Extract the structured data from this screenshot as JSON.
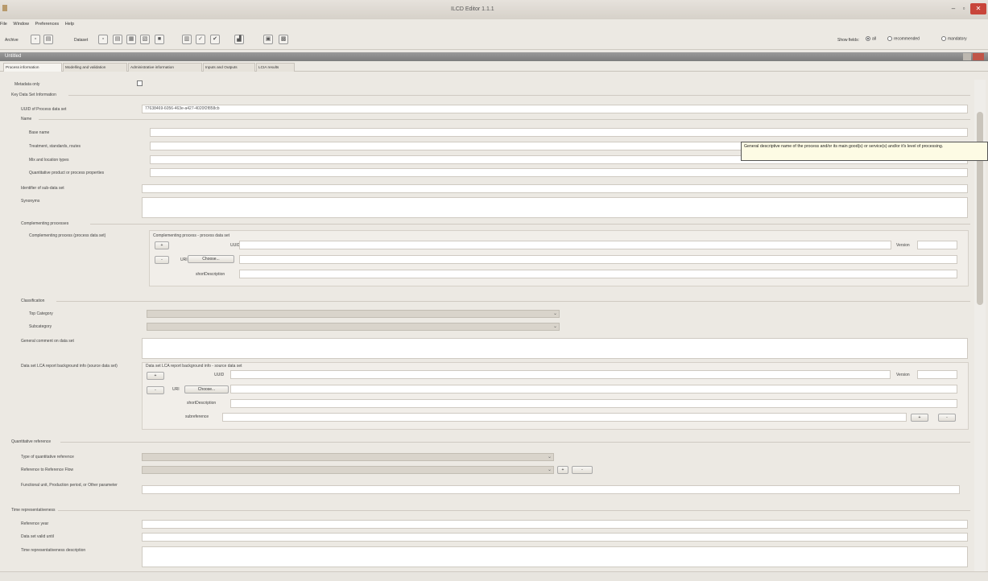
{
  "window": {
    "title": "ILCD Editor 1.1.1",
    "minimize": "–",
    "maximize": "▫",
    "close": "✕"
  },
  "menu": [
    "File",
    "Window",
    "Preferences",
    "Help"
  ],
  "toolbar": {
    "archive_label": "Archive",
    "dataset_label": "Dataset",
    "show_fields_label": "Show fields:",
    "show_fields_options": [
      "all",
      "recommended",
      "mandatory"
    ],
    "show_fields_selected": "all"
  },
  "document": {
    "title": "Untitled"
  },
  "tabs": [
    "Process information",
    "Modelling and validation",
    "Administrative information",
    "Inputs and Outputs",
    "LCIA results"
  ],
  "form": {
    "metadata_only": "Metadata only",
    "key_info": "Key Data Set Information",
    "uuid_label": "UUID of Process data set",
    "uuid_value": "77638469-6056-463e-a427-4020f2f858cb",
    "name": "Name",
    "base_name": "Base name",
    "treatment": "Treatment, standards, routes",
    "mix_location": "Mix and location types",
    "quant_props": "Quantitative product or process properties",
    "sub_dataset": "Identifier of sub-data set",
    "synonyms": "Synonyms",
    "complementing_processes": "Complementing processes",
    "complementing_process": "Complementing process (process data set)",
    "complementing_process_ref": "Complementing process - process data set",
    "uuid": "UUID",
    "version": "Version",
    "uri": "URI",
    "choose": "Choose...",
    "short_description": "shortDescription",
    "classification": "Classification",
    "top_category": "Top Category",
    "subcategory": "Subcategory",
    "general_comment": "General comment on data set",
    "lca_report": "Data set LCA report background info (source data set)",
    "lca_report_ref": "Data set LCA report background info - source data set",
    "subreference": "subreference",
    "quant_ref": "Quantitative reference",
    "type_quant_ref": "Type of quantitative reference",
    "ref_flow": "Reference to Reference Flow",
    "functional_unit": "Functional unit, Production period, or Other parameter",
    "time_repr": "Time representativeness",
    "ref_year": "Reference year",
    "valid_until": "Data set valid until",
    "time_desc": "Time representativeness description",
    "plus": "+",
    "minus": "-"
  },
  "tooltip": {
    "text": "General descriptive name of the process and/or its main good(s) or service(s) and/or it's level of processing."
  }
}
